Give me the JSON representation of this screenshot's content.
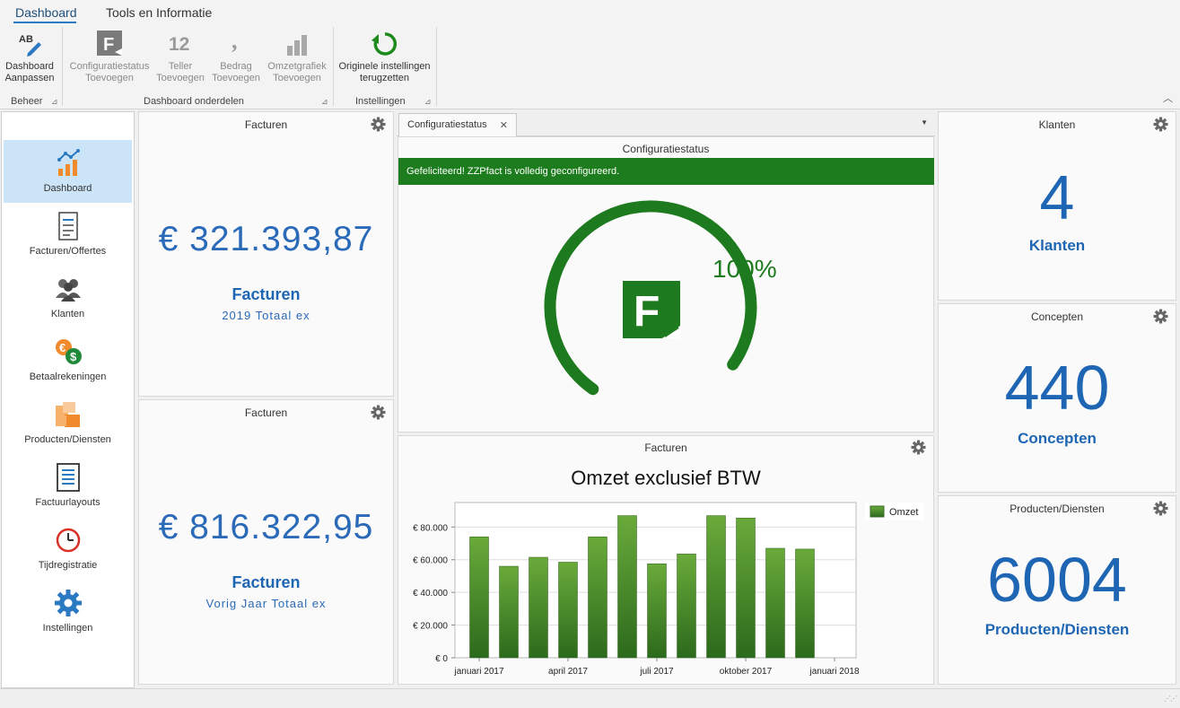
{
  "ribbon": {
    "tabs": [
      "Dashboard",
      "Tools en Informatie"
    ],
    "buttons": {
      "dashboard": "Dashboard\nAanpassen",
      "config": "Configuratiestatus\nToevoegen",
      "teller": "Teller\nToevoegen",
      "bedrag": "Bedrag\nToevoegen",
      "omzet": "Omzetgrafiek\nToevoegen",
      "reset": "Originele instellingen\nterugzetten"
    },
    "groups": {
      "beheer": "Beheer",
      "onderdelen": "Dashboard onderdelen",
      "instellingen": "Instellingen"
    },
    "icons": {
      "teller_glyph": "12",
      "bedrag_glyph": ",",
      "ab_glyph": "AB"
    }
  },
  "sidebar": {
    "items": [
      {
        "label": "Dashboard",
        "icon": "chart-icon"
      },
      {
        "label": "Facturen/Offertes",
        "icon": "document-list-icon"
      },
      {
        "label": "Klanten",
        "icon": "users-icon"
      },
      {
        "label": "Betaalrekeningen",
        "icon": "money-icon"
      },
      {
        "label": "Producten/Diensten",
        "icon": "boxes-icon"
      },
      {
        "label": "Factuurlayouts",
        "icon": "layout-icon"
      },
      {
        "label": "Tijdregistratie",
        "icon": "clock-icon"
      },
      {
        "label": "Instellingen",
        "icon": "gear-icon"
      }
    ]
  },
  "panels": {
    "facturen1": {
      "title": "Facturen",
      "amount": "€ 321.393,87",
      "label": "Facturen",
      "sub": "2019 Totaal ex"
    },
    "facturen2": {
      "title": "Facturen",
      "amount": "€ 816.322,95",
      "label": "Facturen",
      "sub": "Vorig Jaar Totaal ex"
    },
    "config": {
      "tab": "Configuratiestatus",
      "title": "Configuratiestatus",
      "message": "Gefeliciteerd! ZZPfact is volledig geconfigureerd.",
      "percent": "100%",
      "progress": 1.0,
      "logo_letter": "F"
    },
    "chart": {
      "title": "Facturen"
    },
    "klanten": {
      "title": "Klanten",
      "count": "4",
      "label": "Klanten"
    },
    "concepten": {
      "title": "Concepten",
      "count": "440",
      "label": "Concepten"
    },
    "producten": {
      "title": "Producten/Diensten",
      "count": "6004",
      "label": "Producten/Diensten"
    }
  },
  "chart_data": {
    "type": "bar",
    "title": "Omzet exclusief BTW",
    "categories": [
      "2017-01",
      "2017-02",
      "2017-03",
      "2017-04",
      "2017-05",
      "2017-06",
      "2017-07",
      "2017-08",
      "2017-09",
      "2017-10",
      "2017-11",
      "2017-12"
    ],
    "series": [
      {
        "name": "Omzet",
        "values": [
          74000,
          56000,
          61500,
          58500,
          74000,
          87000,
          57500,
          63500,
          87000,
          85500,
          67000,
          66500
        ]
      }
    ],
    "x_tick_labels": [
      "januari 2017",
      "april 2017",
      "juli 2017",
      "oktober 2017",
      "januari 2018"
    ],
    "y_tick_labels": [
      "€ 0",
      "€ 20.000",
      "€ 40.000",
      "€ 60.000",
      "€ 80.000"
    ],
    "ylim": [
      0,
      95000
    ],
    "grid": true,
    "legend": "top-right",
    "colors": {
      "bar_top": "#6aaa3a",
      "bar_bottom": "#2c6a1c"
    }
  },
  "colors": {
    "accent": "#1e66b4",
    "success": "#1d7c1d",
    "sidebar_active": "#cce4f7"
  }
}
